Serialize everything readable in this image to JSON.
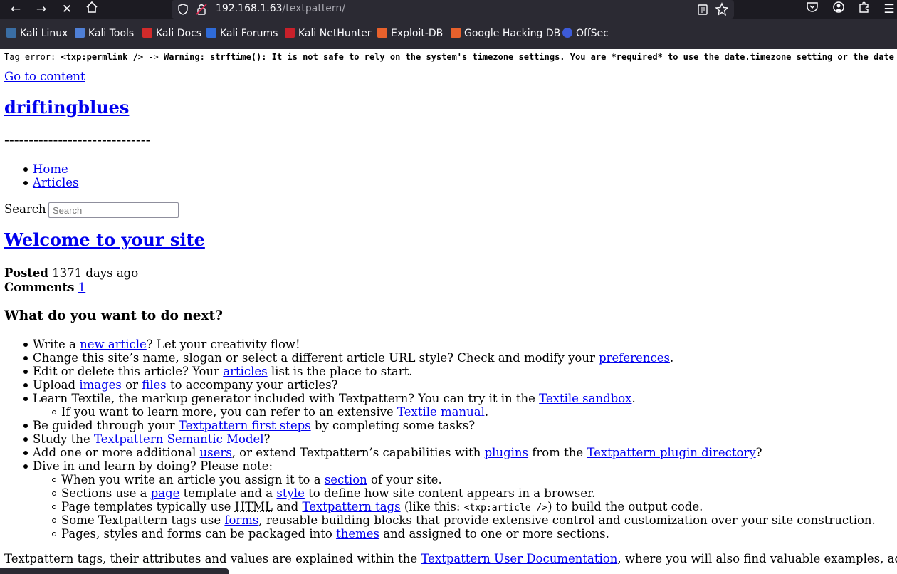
{
  "browser": {
    "url_host": "192.168.1.63",
    "url_path": "/textpattern/",
    "bookmarks": [
      "Kali Linux",
      "Kali Tools",
      "Kali Docs",
      "Kali Forums",
      "Kali NetHunter",
      "Exploit-DB",
      "Google Hacking DB",
      "OffSec"
    ],
    "icons": {
      "back": "arrow-left",
      "forward": "arrow-right",
      "stop": "close",
      "home": "home",
      "pocket": "pocket",
      "account": "account",
      "extensions": "puzzle",
      "menu": "hamburger"
    },
    "accent": "#1c1b22"
  },
  "page": {
    "tag_error_label": "Tag error:",
    "tag_error_tag": "<txp:permlink />",
    "tag_error_arrow": "->",
    "tag_error_warning": "Warning: strftime(): It is not safe to rely on the system's timezone settings. You are *required* to use the date.timezone setting or the date",
    "skip_link": "Go to content",
    "site_title": "driftingblues",
    "divider": "------------------------------",
    "nav": [
      "Home",
      "Articles"
    ],
    "search_label": "Search",
    "search_placeholder": "Search",
    "article_title": "Welcome to your site",
    "posted_label": "Posted",
    "posted_value": "1371 days ago",
    "comments_label": "Comments",
    "comments_value": "1",
    "next_heading": "What do you want to do next?",
    "l1": {
      "a": "Write a ",
      "link": "new article",
      "b": "? Let your creativity flow!"
    },
    "l2": {
      "a": "Change this site’s name, slogan or select a different article URL style? Check and modify your ",
      "link": "preferences",
      "b": "."
    },
    "l3": {
      "a": "Edit or delete this article? Your ",
      "link": "articles",
      "b": " list is the place to start."
    },
    "l4": {
      "a": "Upload ",
      "link1": "images",
      "b": " or ",
      "link2": "files",
      "c": " to accompany your articles?"
    },
    "l5": {
      "a": "Learn Textile, the markup generator included with Textpattern? You can try it in the ",
      "link": "Textile sandbox",
      "b": "."
    },
    "l5s": {
      "a": "If you want to learn more, you can refer to an extensive ",
      "link": "Textile manual",
      "b": "."
    },
    "l6": {
      "a": "Be guided through your ",
      "link": "Textpattern first steps",
      "b": " by completing some tasks?"
    },
    "l7": {
      "a": "Study the ",
      "link": "Textpattern Semantic Model",
      "b": "?"
    },
    "l8": {
      "a": "Add one or more additional ",
      "link1": "users",
      "b": ", or extend Textpattern’s capabilities with ",
      "link2": "plugins",
      "c": " from the ",
      "link3": "Textpattern plugin directory",
      "d": "?"
    },
    "l9": {
      "a": "Dive in and learn by doing? Please note:"
    },
    "s1": {
      "a": "When you write an article you assign it to a ",
      "link": "section",
      "b": " of your site."
    },
    "s2": {
      "a": "Sections use a ",
      "link1": "page",
      "b": " template and a ",
      "link2": "style",
      "c": " to define how site content appears in a browser."
    },
    "s3": {
      "a": "Page templates typically use ",
      "abbr": "HTML",
      "b": " and ",
      "link": "Textpattern tags",
      "c": " (like this: ",
      "code": "<txp:article />",
      "d": ") to build the output code."
    },
    "s4": {
      "a": "Some Textpattern tags use ",
      "link": "forms",
      "b": ", reusable building blocks that provide extensive control and customization over your site construction."
    },
    "s5": {
      "a": "Pages, styles and forms can be packaged into ",
      "link": "themes",
      "b": " and assigned to one or more sections."
    },
    "footer": {
      "a": "Textpattern tags, their attributes and values are explained within the ",
      "link": "Textpattern User Documentation",
      "b": ", where you will also find valuable examples, advice"
    }
  }
}
